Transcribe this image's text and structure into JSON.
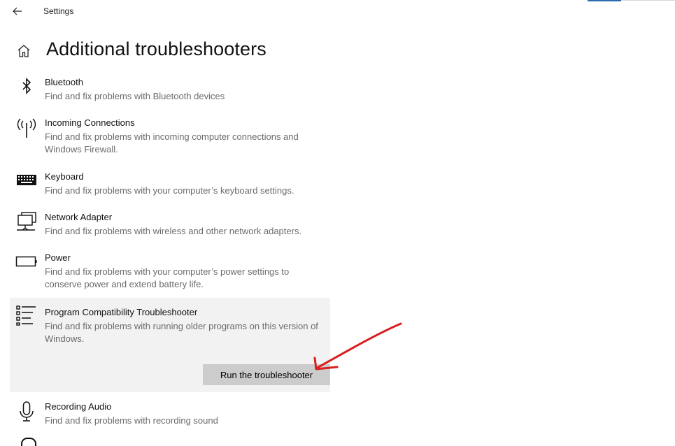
{
  "window": {
    "title": "Settings"
  },
  "page": {
    "title": "Additional troubleshooters"
  },
  "items": [
    {
      "icon": "bluetooth-icon",
      "name": "Bluetooth",
      "desc": "Find and fix problems with Bluetooth devices"
    },
    {
      "icon": "antenna-icon",
      "name": "Incoming Connections",
      "desc": "Find and fix problems with incoming computer connections and Windows Firewall."
    },
    {
      "icon": "keyboard-icon",
      "name": "Keyboard",
      "desc": "Find and fix problems with your computer’s keyboard settings."
    },
    {
      "icon": "network-adapter-icon",
      "name": "Network Adapter",
      "desc": "Find and fix problems with wireless and other network adapters."
    },
    {
      "icon": "battery-icon",
      "name": "Power",
      "desc": "Find and fix problems with your computer’s power settings to conserve power and extend battery life."
    },
    {
      "icon": "list-icon",
      "name": "Program Compatibility Troubleshooter",
      "desc": "Find and fix problems with running older programs on this version of Windows.",
      "selected": true,
      "button": "Run the troubleshooter"
    },
    {
      "icon": "microphone-icon",
      "name": "Recording Audio",
      "desc": "Find and fix problems with recording sound"
    }
  ],
  "colors": {
    "accent": "#2b6cb0",
    "selected_bg": "#f2f2f2",
    "button_bg": "#cccccc",
    "annotation": "#d9201f"
  }
}
